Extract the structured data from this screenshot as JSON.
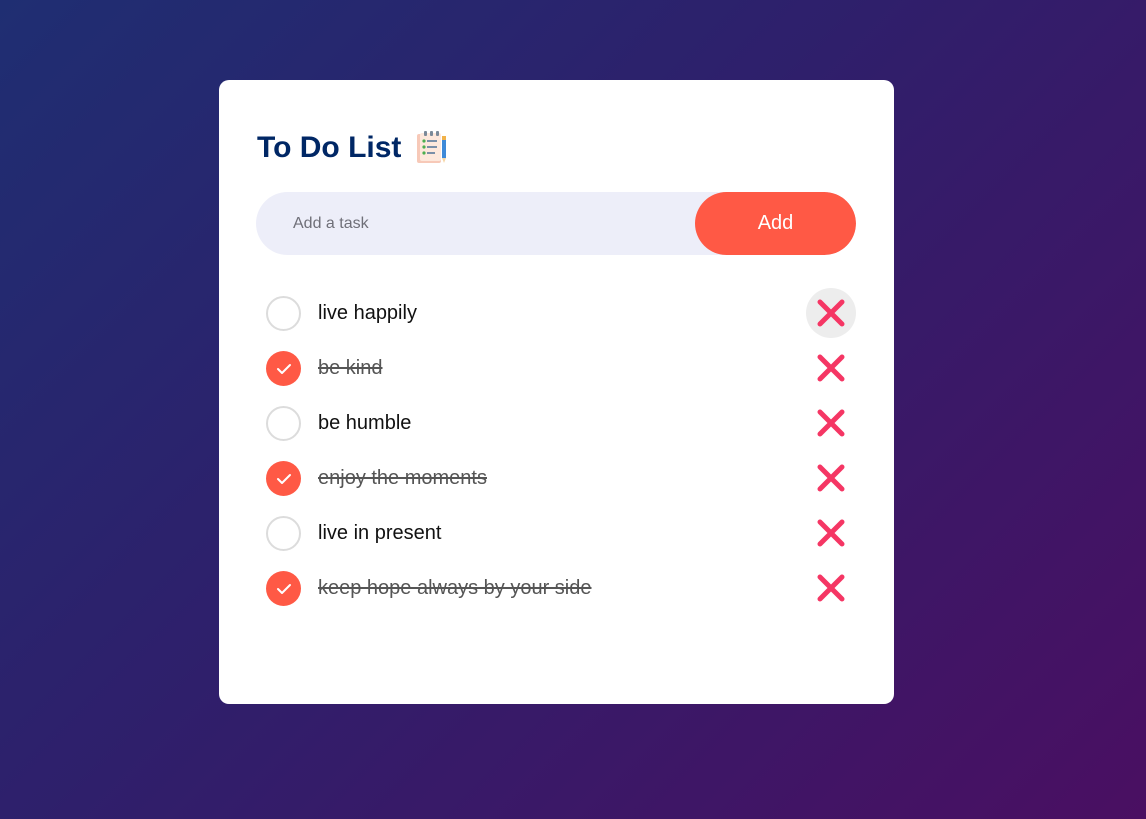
{
  "app": {
    "title": "To Do List",
    "title_icon": "notepad-checklist-icon"
  },
  "input": {
    "placeholder": "Add a task",
    "value": ""
  },
  "add_button": {
    "label": "Add"
  },
  "colors": {
    "accent": "#ff5945",
    "title": "#002765",
    "delete": "#f53664",
    "input_bg": "#edeef9"
  },
  "tasks": [
    {
      "text": "live happily",
      "checked": false,
      "delete_icon": "close-icon"
    },
    {
      "text": "be kind",
      "checked": true,
      "delete_icon": "close-icon"
    },
    {
      "text": "be humble",
      "checked": false,
      "delete_icon": "close-icon"
    },
    {
      "text": "enjoy the moments",
      "checked": true,
      "delete_icon": "close-icon"
    },
    {
      "text": "live in present",
      "checked": false,
      "delete_icon": "close-icon"
    },
    {
      "text": "keep hope always by your side",
      "checked": true,
      "delete_icon": "close-icon"
    }
  ]
}
